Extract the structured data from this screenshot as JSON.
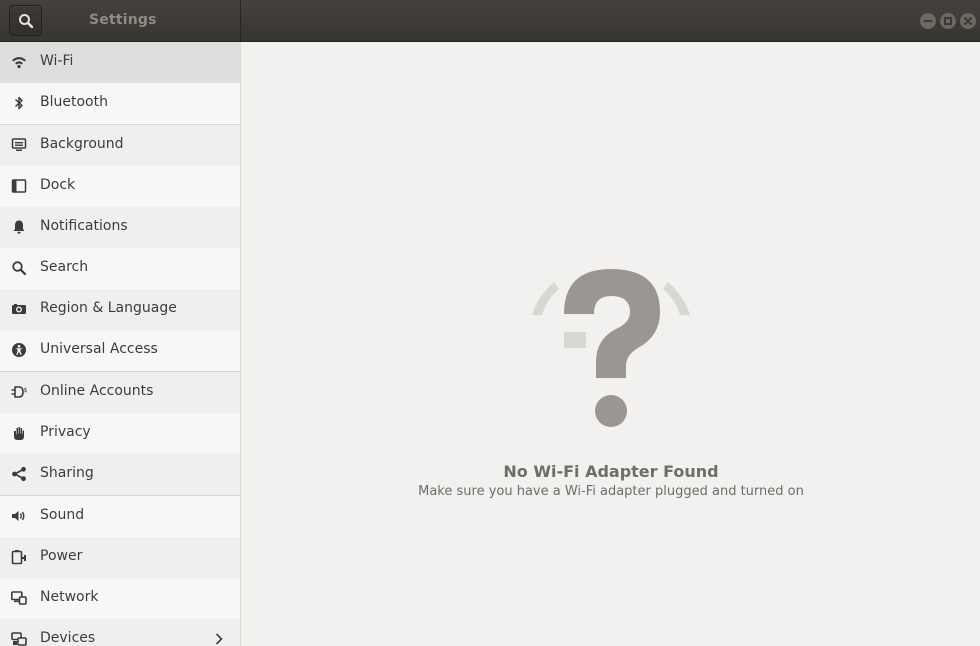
{
  "window": {
    "title": "Settings"
  },
  "sidebar": {
    "items": [
      {
        "label": "Wi-Fi",
        "icon": "wifi-icon"
      },
      {
        "label": "Bluetooth",
        "icon": "bluetooth-icon"
      },
      {
        "label": "Background",
        "icon": "background-icon"
      },
      {
        "label": "Dock",
        "icon": "dock-icon"
      },
      {
        "label": "Notifications",
        "icon": "bell-icon"
      },
      {
        "label": "Search",
        "icon": "search-icon"
      },
      {
        "label": "Region & Language",
        "icon": "camera-icon"
      },
      {
        "label": "Universal Access",
        "icon": "accessibility-icon"
      },
      {
        "label": "Online Accounts",
        "icon": "online-accounts-icon"
      },
      {
        "label": "Privacy",
        "icon": "hand-icon"
      },
      {
        "label": "Sharing",
        "icon": "share-icon"
      },
      {
        "label": "Sound",
        "icon": "speaker-icon"
      },
      {
        "label": "Power",
        "icon": "battery-icon"
      },
      {
        "label": "Network",
        "icon": "network-icon"
      },
      {
        "label": "Devices",
        "icon": "devices-icon"
      }
    ],
    "selected": "Wi-Fi"
  },
  "main": {
    "status_title": "No Wi-Fi Adapter Found",
    "status_description": "Make sure you have a Wi-Fi adapter plugged and turned on",
    "status_icon": "wifi-unknown-icon"
  },
  "colors": {
    "headerbar": "#3c3a35",
    "sidebar_selected": "#dfdedc",
    "content_bg": "#f2f1f0",
    "status_text": "#6f6d69",
    "icon_gray": "#9a9691"
  }
}
